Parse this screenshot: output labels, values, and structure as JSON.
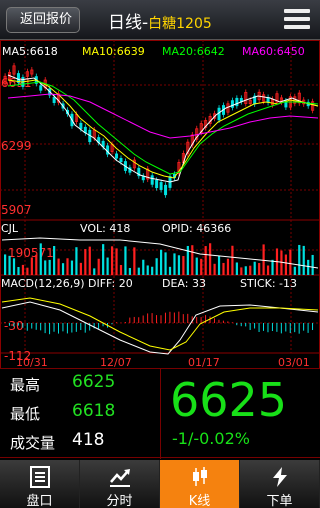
{
  "header": {
    "back_label": "返回报价",
    "title_prefix": "日线-",
    "title_symbol": "白糖1205"
  },
  "ma": {
    "ma5": "MA5:6618",
    "ma10": "MA10:6639",
    "ma20": "MA20:6642",
    "ma60": "MA60:6450"
  },
  "price_axis": {
    "high": "6691",
    "mid": "6299",
    "low": "5907"
  },
  "vol": {
    "label": "CJL",
    "vol": "VOL: 418",
    "opid": "OPID: 46366",
    "axis": "190571"
  },
  "macd": {
    "label": "MACD(12,26,9)",
    "diff": "DIFF: 20",
    "dea": "DEA: 33",
    "stick": "STICK: -13",
    "axis_top": "-30",
    "axis_bottom": "-112"
  },
  "dates": [
    "10/31",
    "12/07",
    "01/17",
    "03/01"
  ],
  "quote": {
    "high_label": "最高",
    "high_value": "6625",
    "low_label": "最低",
    "low_value": "6618",
    "vol_label": "成交量",
    "vol_value": "418",
    "price": "6625",
    "change": "-1/-0.02%"
  },
  "tabs": [
    {
      "label": "盘口",
      "icon": "list-icon"
    },
    {
      "label": "分时",
      "icon": "trend-line-icon"
    },
    {
      "label": "K线",
      "icon": "candlestick-icon"
    },
    {
      "label": "下单",
      "icon": "lightning-icon"
    }
  ],
  "colors": {
    "up": "#ff2020",
    "down": "#00e0e0",
    "ma5": "#ffffff",
    "ma10": "#ffff00",
    "ma20": "#00ff00",
    "ma60": "#ff00ff",
    "price_green": "#18e018"
  }
}
